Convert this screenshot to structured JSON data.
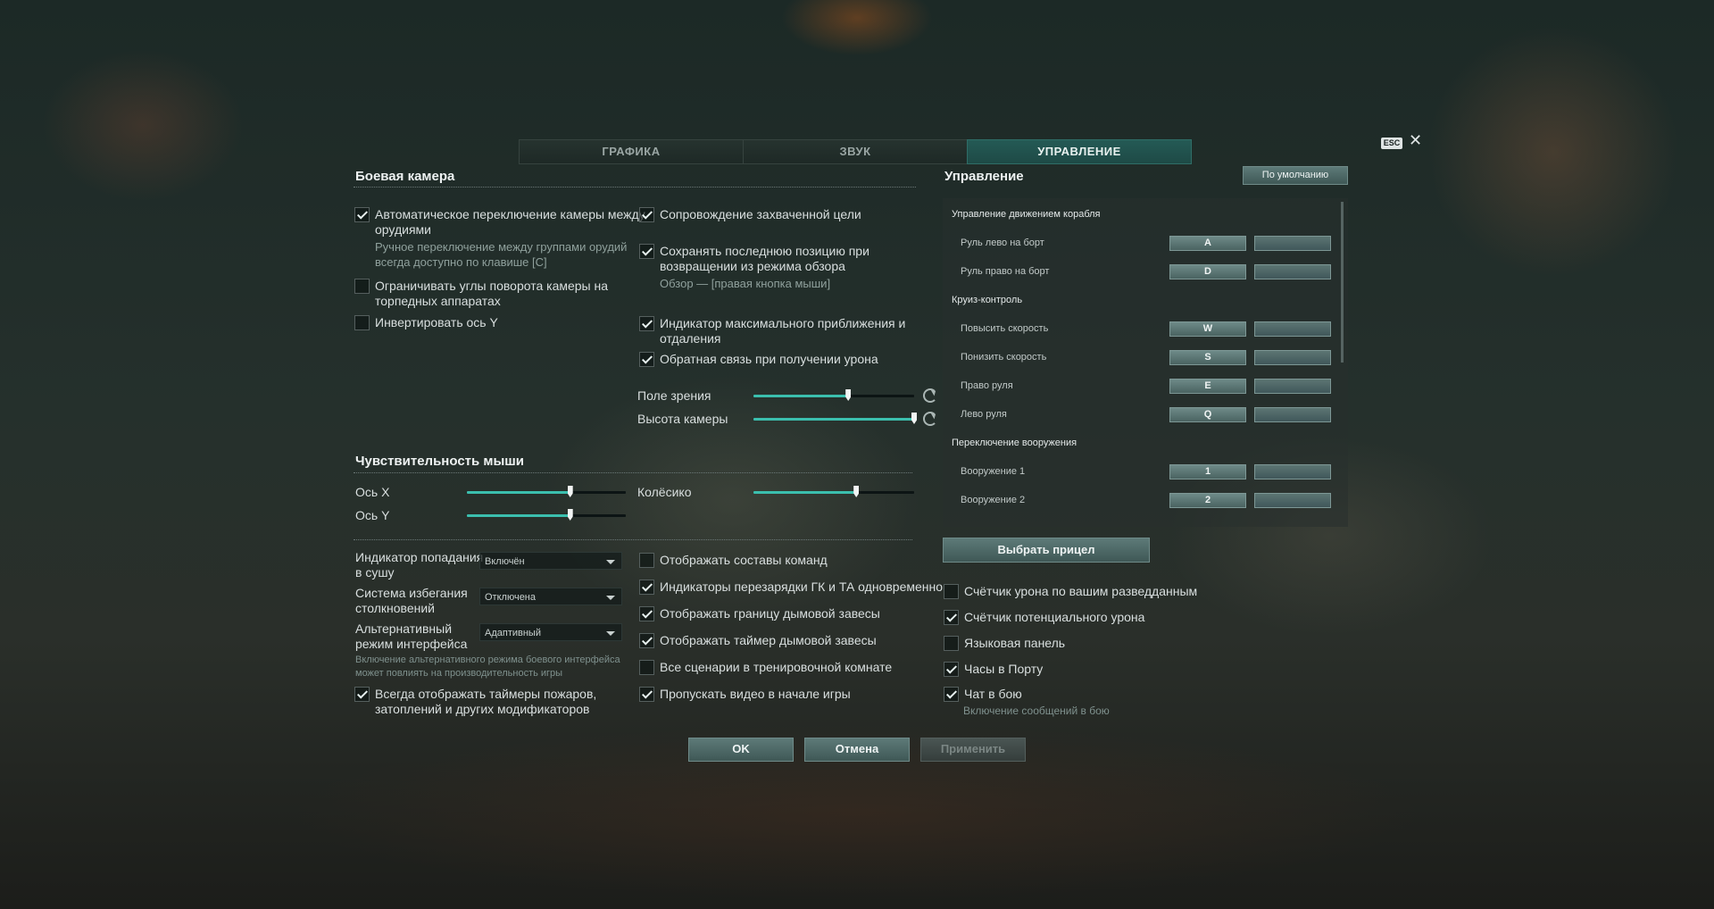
{
  "tabs": [
    {
      "label": "ГРАФИКА",
      "active": false
    },
    {
      "label": "ЗВУК",
      "active": false
    },
    {
      "label": "УПРАВЛЕНИЕ",
      "active": true
    }
  ],
  "esc": "ESC",
  "close": "✕",
  "camera": {
    "title": "Боевая камера",
    "auto_switch": {
      "label1": "Автоматическое переключение камеры между",
      "label2": "орудиями",
      "checked": true
    },
    "auto_switch_hint1": "Ручное переключение между группами орудий",
    "auto_switch_hint2": "всегда доступно по клавише [C]",
    "limit_angles": {
      "label1": "Ограничивать углы поворота камеры на",
      "label2": "торпедных аппаратах",
      "checked": false
    },
    "invert_y": {
      "label": "Инвертировать ось Y",
      "checked": false
    },
    "follow_target": {
      "label": "Сопровождение захваченной цели",
      "checked": true
    },
    "save_position": {
      "label1": "Сохранять последнюю позицию при",
      "label2": "возвращении из режима обзора",
      "checked": true
    },
    "save_position_hint": "Обзор — [правая кнопка мыши]",
    "zoom_indicator": {
      "label1": "Индикатор максимального приближения и",
      "label2": "отдаления",
      "checked": true
    },
    "damage_feedback": {
      "label": "Обратная связь при получении урона",
      "checked": true
    },
    "fov": {
      "label": "Поле зрения",
      "value": 0.59
    },
    "camera_height": {
      "label": "Высота камеры",
      "value": 1.0
    }
  },
  "mouse": {
    "title": "Чувствительность мыши",
    "axis_x": {
      "label": "Ось X",
      "value": 0.65
    },
    "axis_y": {
      "label": "Ось Y",
      "value": 0.65
    },
    "wheel": {
      "label": "Колёсико",
      "value": 0.64
    }
  },
  "misc": {
    "ground_hit": {
      "label1": "Индикатор попадания",
      "label2": "в сушу",
      "value": "Включён"
    },
    "collision": {
      "label1": "Система избегания",
      "label2": "столкновений",
      "value": "Отключена"
    },
    "alt_ui": {
      "label1": "Альтернативный",
      "label2": "режим интерфейса",
      "value": "Адаптивный"
    },
    "alt_ui_hint1": "Включение альтернативного режима боевого интерфейса",
    "alt_ui_hint2": "может повлиять на производительность игры",
    "timers": {
      "label1": "Всегда отображать таймеры пожаров,",
      "label2": "затоплений и других модификаторов",
      "checked": true
    },
    "team_lists": {
      "label": "Отображать составы команд",
      "checked": false
    },
    "reload_indicators": {
      "label": "Индикаторы перезарядки ГК и ТА одновременно",
      "checked": true
    },
    "smoke_border": {
      "label": "Отображать границу дымовой завесы",
      "checked": true
    },
    "smoke_timer": {
      "label": "Отображать таймер дымовой завесы",
      "checked": true
    },
    "training_scenarios": {
      "label": "Все сценарии в тренировочной комнате",
      "checked": false
    },
    "skip_video": {
      "label": "Пропускать видео в начале игры",
      "checked": true
    }
  },
  "controls": {
    "title": "Управление",
    "default_button": "По умолчанию",
    "groups": [
      {
        "label": "Управление движением корабля",
        "actions": [
          {
            "label": "Руль лево на борт",
            "key1": "A",
            "key2": ""
          },
          {
            "label": "Руль право на борт",
            "key1": "D",
            "key2": ""
          }
        ]
      },
      {
        "label": "Круиз-контроль",
        "actions": [
          {
            "label": "Повысить скорость",
            "key1": "W",
            "key2": ""
          },
          {
            "label": "Понизить скорость",
            "key1": "S",
            "key2": ""
          },
          {
            "label": "Право руля",
            "key1": "E",
            "key2": ""
          },
          {
            "label": "Лево руля",
            "key1": "Q",
            "key2": ""
          }
        ]
      },
      {
        "label": "Переключение вооружения",
        "actions": [
          {
            "label": "Вооружение 1",
            "key1": "1",
            "key2": ""
          },
          {
            "label": "Вооружение 2",
            "key1": "2",
            "key2": ""
          }
        ]
      }
    ],
    "choose_sight": "Выбрать прицел"
  },
  "right_options": {
    "scouted_damage": {
      "label": "Счётчик урона по вашим разведданным",
      "checked": false
    },
    "potential_damage": {
      "label": "Счётчик потенциального урона",
      "checked": true
    },
    "language_bar": {
      "label": "Языковая панель",
      "checked": false
    },
    "port_clock": {
      "label": "Часы в Порту",
      "checked": true
    },
    "battle_chat": {
      "label": "Чат в бою",
      "checked": true
    },
    "battle_chat_hint": "Включение сообщений в бою"
  },
  "footer": {
    "ok": "OK",
    "cancel": "Отмена",
    "apply": "Применить"
  }
}
